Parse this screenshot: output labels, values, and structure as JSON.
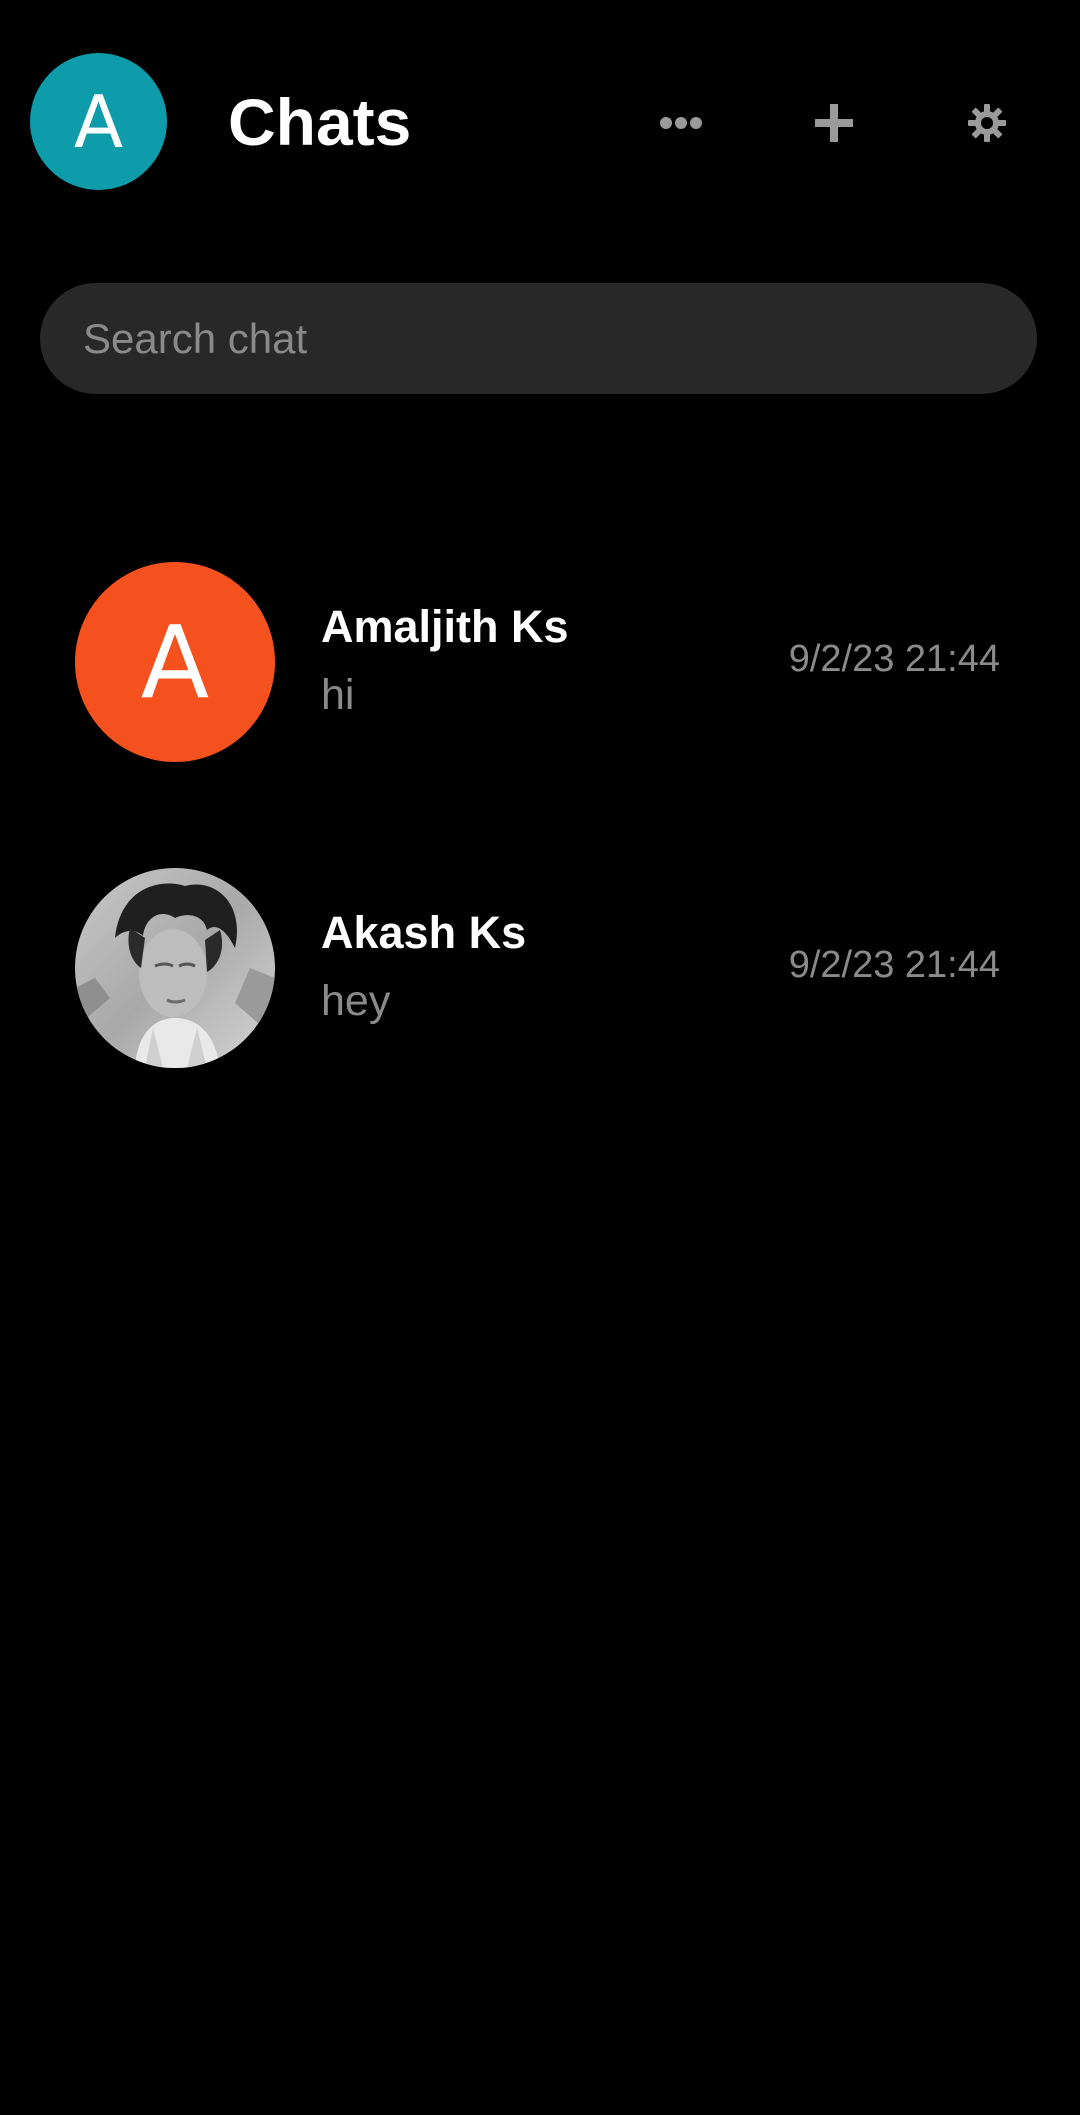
{
  "header": {
    "profile_initial": "A",
    "title": "Chats",
    "more_icon": "more-horizontal-icon",
    "add_icon": "plus-icon",
    "settings_icon": "gear-icon"
  },
  "search": {
    "placeholder": "Search chat",
    "value": ""
  },
  "chats": [
    {
      "name": "Amaljith Ks",
      "preview": "hi",
      "time": "9/2/23 21:44",
      "avatar_initial": "A",
      "avatar_type": "initial"
    },
    {
      "name": "Akash Ks",
      "preview": "hey",
      "time": "9/2/23 21:44",
      "avatar_initial": "",
      "avatar_type": "photo"
    }
  ],
  "colors": {
    "background": "#000000",
    "profile_avatar": "#0E9BAA",
    "chat_avatar_1": "#F4511E",
    "search_background": "#282828",
    "secondary_text": "#8a8a8a",
    "icon": "#9a9a9a"
  }
}
